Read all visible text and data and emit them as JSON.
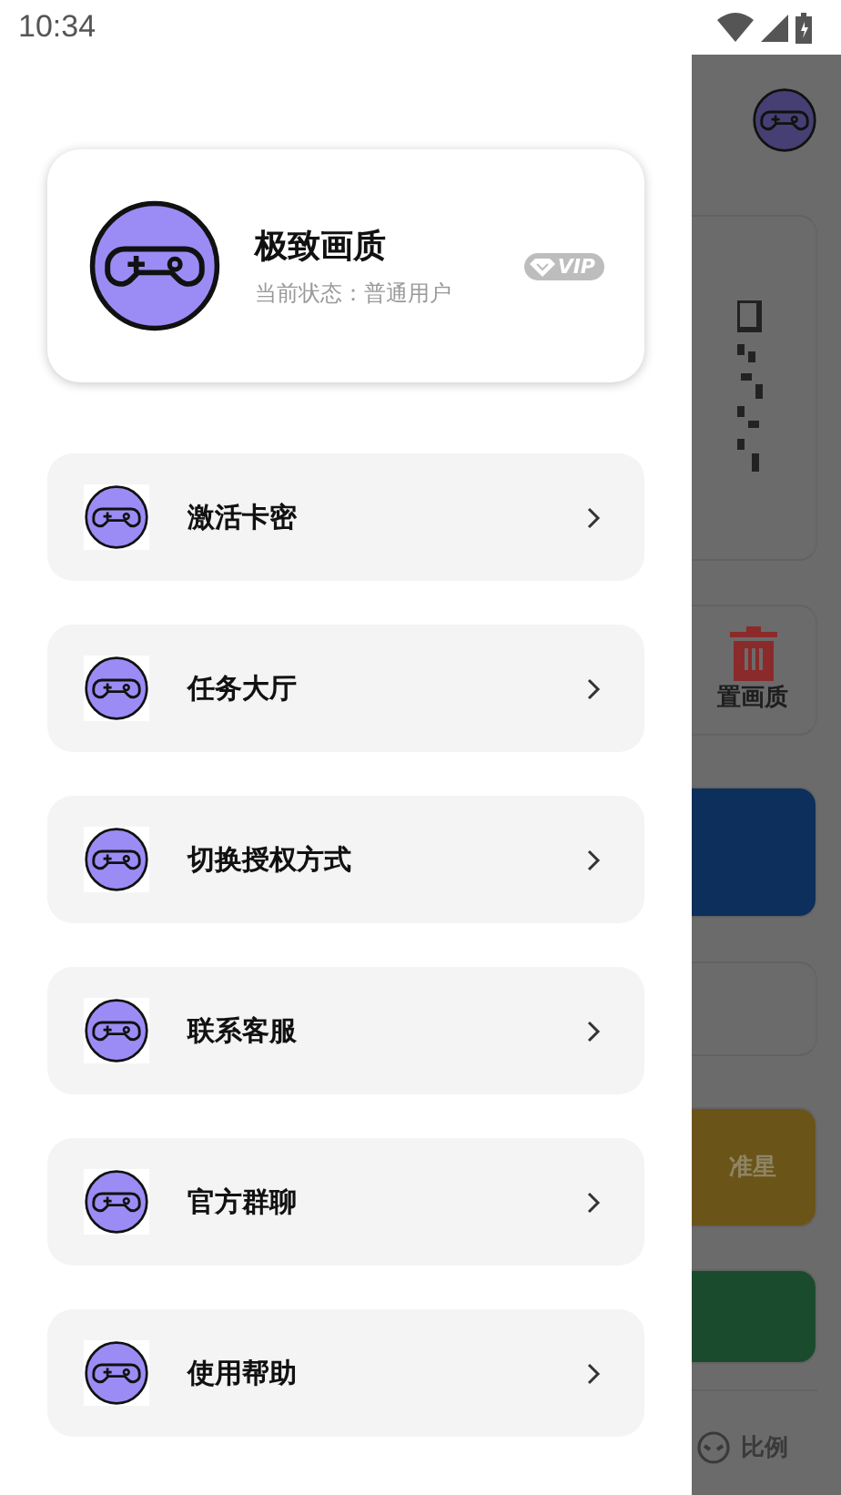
{
  "status_bar": {
    "time": "10:34"
  },
  "profile": {
    "title": "极致画质",
    "status": "当前状态：普通用户",
    "badge": "VIP"
  },
  "menu": [
    {
      "label": "激活卡密"
    },
    {
      "label": "任务大厅"
    },
    {
      "label": "切换授权方式"
    },
    {
      "label": "联系客服"
    },
    {
      "label": "官方群聊"
    },
    {
      "label": "使用帮助"
    }
  ],
  "background": {
    "reset_label": "置画质",
    "crosshair_label": "准星",
    "ratio_label": "比例"
  }
}
